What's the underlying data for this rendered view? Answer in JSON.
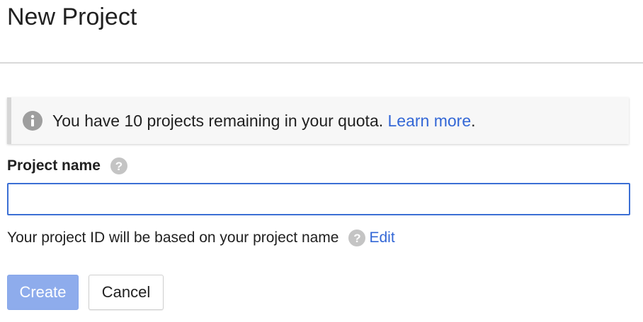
{
  "header": {
    "title": "New Project"
  },
  "notice": {
    "icon": "info-icon",
    "text": "You have 10 projects remaining in your quota.",
    "link_label": "Learn more",
    "trailing": "."
  },
  "project_name": {
    "label": "Project name",
    "help_icon": "help-icon",
    "value": "",
    "placeholder": ""
  },
  "project_id": {
    "text": "Your project ID will be based on your project name",
    "help_icon": "help-icon",
    "edit_label": "Edit"
  },
  "actions": {
    "create_label": "Create",
    "cancel_label": "Cancel"
  },
  "colors": {
    "link": "#3367d6",
    "create_button_disabled": "#8eacec",
    "input_focus_border": "#3b6fd4",
    "info_icon": "#9e9e9e",
    "help_icon": "#c4c4c4"
  }
}
